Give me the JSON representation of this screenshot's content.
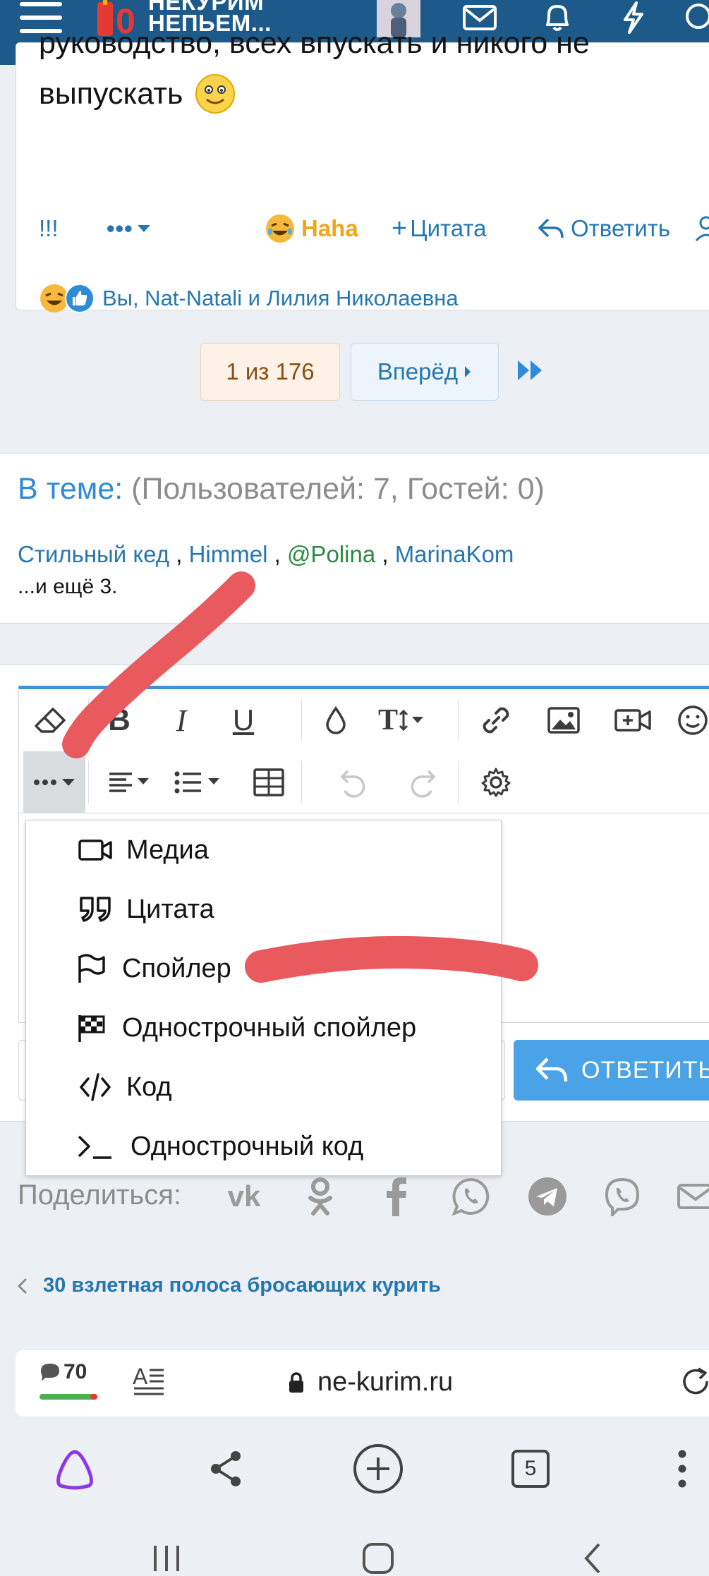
{
  "header": {
    "logo_line1": "НЕКУРИМ",
    "logo_line2": "НЕПЬЕМ..."
  },
  "post": {
    "text_line1": "руководство, всех впускать и никого не",
    "text_line2": "выпускать",
    "exclaim_label": "!!!",
    "more_label": "•••",
    "haha_label": "Haha",
    "quote_label": "Цитата",
    "reply_label": "Ответить",
    "reactions_text": "Вы, Nat-Natali и Лилия Николаевна"
  },
  "pagination": {
    "current": "1 из 176",
    "next": "Вперёд"
  },
  "online": {
    "title": "В теме:",
    "counts": "(Пользователей: 7, Гостей: 0)",
    "users": [
      "Стильный кед",
      "Himmel",
      "@Polina",
      "MarinaKom"
    ],
    "more": "...и ещё 3."
  },
  "insert_menu": {
    "items": [
      {
        "label": "Медиа",
        "icon": "video-icon"
      },
      {
        "label": "Цитата",
        "icon": "quote-icon"
      },
      {
        "label": "Спойлер",
        "icon": "flag-icon"
      },
      {
        "label": "Однострочный спойлер",
        "icon": "checkered-flag-icon"
      },
      {
        "label": "Код",
        "icon": "code-icon"
      },
      {
        "label": "Однострочный код",
        "icon": "terminal-icon"
      }
    ]
  },
  "reply_button_label": "ОТВЕТИТЬ",
  "share": {
    "label": "Поделиться:",
    "networks": [
      "vk-icon",
      "odnoklassniki-icon",
      "facebook-icon",
      "whatsapp-icon",
      "telegram-icon",
      "viber-icon",
      "mail-icon"
    ]
  },
  "breadcrumb": {
    "label": "30 взлетная полоса бросающих курить"
  },
  "browser": {
    "comments_count": "70",
    "url": "ne-kurim.ru",
    "tabs_count": "5"
  },
  "colors": {
    "header_bg": "#1d5a8a",
    "link": "#2577b1",
    "accent_blue": "#3f93d6",
    "annotation_red": "#e85a5e"
  }
}
